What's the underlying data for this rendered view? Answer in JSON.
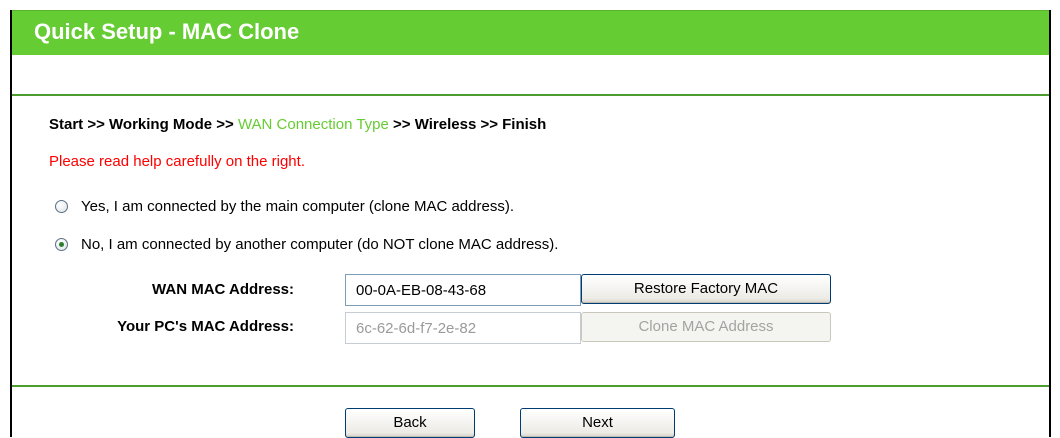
{
  "header": {
    "title": "Quick Setup - MAC Clone"
  },
  "breadcrumb": {
    "start": "Start >> Working Mode >> ",
    "active": "WAN Connection Type",
    "end": " >> Wireless >> Finish"
  },
  "help_note": "Please read help carefully on the right.",
  "options": [
    {
      "label": "Yes, I am connected by the main computer (clone MAC address).",
      "checked": false
    },
    {
      "label": "No, I am connected by another computer (do NOT clone MAC address).",
      "checked": true
    }
  ],
  "wan_mac": {
    "label": "WAN MAC Address:",
    "value": "00-0A-EB-08-43-68",
    "button": "Restore Factory MAC"
  },
  "pc_mac": {
    "label": "Your PC's MAC Address:",
    "value": "6c-62-6d-f7-2e-82",
    "button": "Clone MAC Address"
  },
  "nav": {
    "back": "Back",
    "next": "Next"
  },
  "colors": {
    "header": "#66cc33",
    "active_step": "#66cc33",
    "warning": "#ff0000",
    "rule": "#4a9d2e"
  }
}
